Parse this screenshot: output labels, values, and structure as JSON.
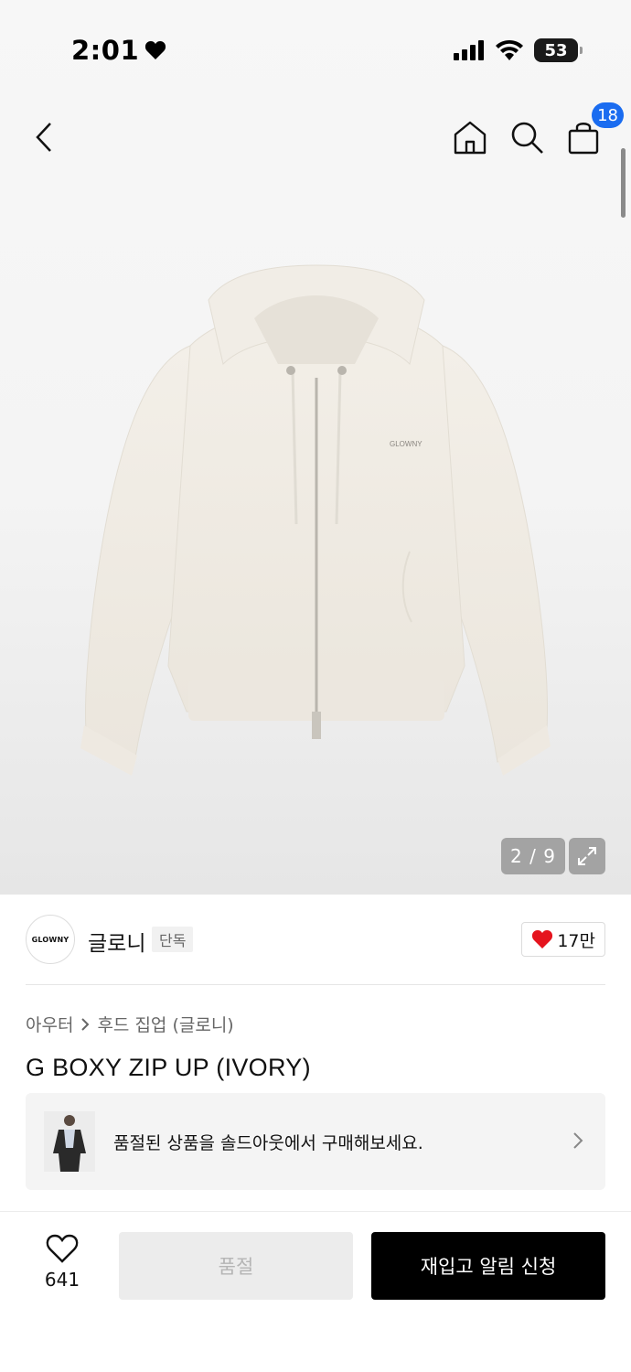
{
  "status_bar": {
    "time": "2:01",
    "battery": "53"
  },
  "nav": {
    "back_icon": "chevron-left-icon",
    "home_icon": "home-icon",
    "search_icon": "search-icon",
    "cart_icon": "shopping-bag-icon",
    "cart_count": "18"
  },
  "gallery": {
    "counter": "2 / 9",
    "expand_icon": "expand-icon",
    "image_logo_text": "GLOWNY"
  },
  "brand": {
    "logo_text": "GLOWNY",
    "name": "글로니",
    "tag": "단독",
    "like_count": "17만",
    "heart_color": "#e5141e"
  },
  "breadcrumb": {
    "category": "아우터",
    "sub_category": "후드 집업 (글로니)"
  },
  "product": {
    "title": "G BOXY ZIP UP (IVORY)"
  },
  "soldout_banner": {
    "text": "품절된 상품을 솔드아웃에서 구매해보세요."
  },
  "bottom_bar": {
    "wish_count": "641",
    "soldout_label": "품절",
    "restock_label": "재입고 알림 신청"
  },
  "colors": {
    "badge": "#1a6cf0",
    "primary_button": "#000000",
    "disabled_button": "#ececec"
  }
}
